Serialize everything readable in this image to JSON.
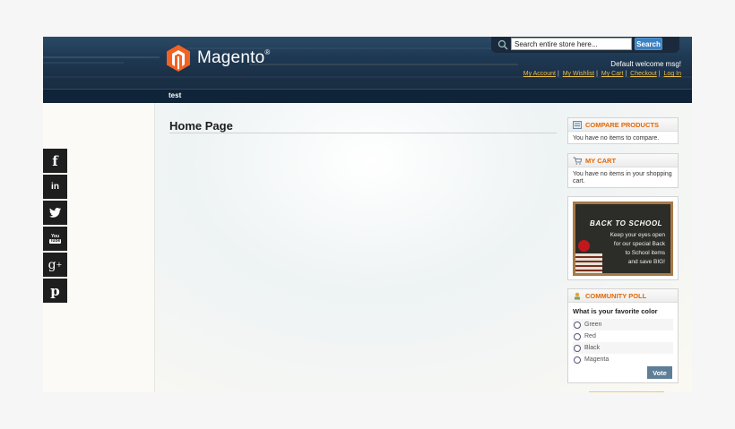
{
  "header": {
    "logo_text": "Magento",
    "logo_reg": "®",
    "search": {
      "placeholder": "Search entire store here...",
      "value": "Search entire store here...",
      "button_label": "Search"
    },
    "welcome": "Default welcome msg!",
    "links": [
      "My Account",
      "My Wishlist",
      "My Cart",
      "Checkout",
      "Log In"
    ],
    "separator": "|"
  },
  "nav": {
    "items": [
      "test"
    ]
  },
  "main": {
    "title": "Home Page"
  },
  "social": {
    "icons": [
      "facebook-icon",
      "linkedin-icon",
      "twitter-icon",
      "youtube-icon",
      "google-plus-icon",
      "pinterest-icon"
    ],
    "glyphs": [
      "f",
      "in",
      "🐦",
      "You Tube",
      "g+",
      "P"
    ]
  },
  "sidebar": {
    "compare": {
      "title": "COMPARE PRODUCTS",
      "text": "You have no items to compare."
    },
    "cart": {
      "title": "MY CART",
      "text": "You have no items in your shopping cart."
    },
    "promo": {
      "title": "BACK TO SCHOOL",
      "lines": [
        "Keep your eyes open",
        "for our special Back",
        "to School items",
        "and save BIG!"
      ]
    },
    "poll": {
      "title": "COMMUNITY POLL",
      "question": "What is your favorite color",
      "options": [
        "Green",
        "Red",
        "Black",
        "Magenta"
      ],
      "vote_label": "Vote"
    }
  },
  "colors": {
    "header_bg": "#1f3a55",
    "accent_orange": "#e26703",
    "link_yellow": "#e8bb4a",
    "search_blue": "#3c82c3",
    "vote_button": "#5e7e98"
  }
}
